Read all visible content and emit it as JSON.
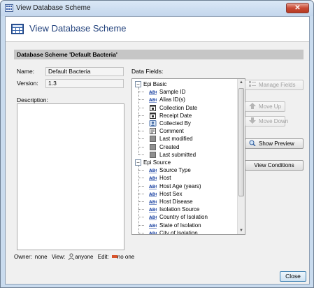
{
  "window": {
    "title": "View Database Scheme",
    "close_glyph": "✕"
  },
  "header": {
    "title": "View Database Scheme"
  },
  "scheme_bar": {
    "label": "Database Scheme 'Default Bacteria'"
  },
  "form": {
    "name_label": "Name:",
    "name_value": "Default Bacteria",
    "version_label": "Version:",
    "version_value": "1.3",
    "description_label": "Description:",
    "data_fields_label": "Data Fields:"
  },
  "tree": {
    "groups": [
      {
        "label": "Epi Basic",
        "expanded": true,
        "items": [
          {
            "label": "Sample ID",
            "icon": "text-field-icon"
          },
          {
            "label": "Alias ID(s)",
            "icon": "text-field-icon"
          },
          {
            "label": "Collection Date",
            "icon": "date-field-icon"
          },
          {
            "label": "Receipt Date",
            "icon": "date-field-icon"
          },
          {
            "label": "Collected By",
            "icon": "user-field-icon"
          },
          {
            "label": "Comment",
            "icon": "comment-field-icon"
          },
          {
            "label": "Last modified",
            "icon": "system-field-icon"
          },
          {
            "label": "Created",
            "icon": "system-field-icon"
          },
          {
            "label": "Last submitted",
            "icon": "system-field-icon"
          }
        ]
      },
      {
        "label": "Epi Source",
        "expanded": true,
        "items": [
          {
            "label": "Source Type",
            "icon": "text-field-icon"
          },
          {
            "label": "Host",
            "icon": "text-field-icon"
          },
          {
            "label": "Host Age (years)",
            "icon": "text-field-icon"
          },
          {
            "label": "Host Sex",
            "icon": "text-field-icon"
          },
          {
            "label": "Host Disease",
            "icon": "text-field-icon"
          },
          {
            "label": "Isolation Source",
            "icon": "text-field-icon"
          },
          {
            "label": "Country of Isolation",
            "icon": "text-field-icon"
          },
          {
            "label": "State of Isolation",
            "icon": "text-field-icon"
          },
          {
            "label": "City of Isolation",
            "icon": "text-field-icon"
          }
        ]
      }
    ],
    "expand_glyph": "−"
  },
  "buttons": {
    "manage_fields": "Manage Fields",
    "move_up": "Move Up",
    "move_down": "Move Down",
    "show_preview": "Show Preview",
    "view_conditions": "View Conditions",
    "close": "Close"
  },
  "footer": {
    "owner_label": "Owner:",
    "owner_value": "none",
    "view_label": "View:",
    "view_value": "anyone",
    "edit_label": "Edit:",
    "edit_value": "no one"
  },
  "colors": {
    "header_title": "#1f3f7a",
    "text_icon_blue": "#2a4fa8",
    "close_red": "#c94a35"
  }
}
